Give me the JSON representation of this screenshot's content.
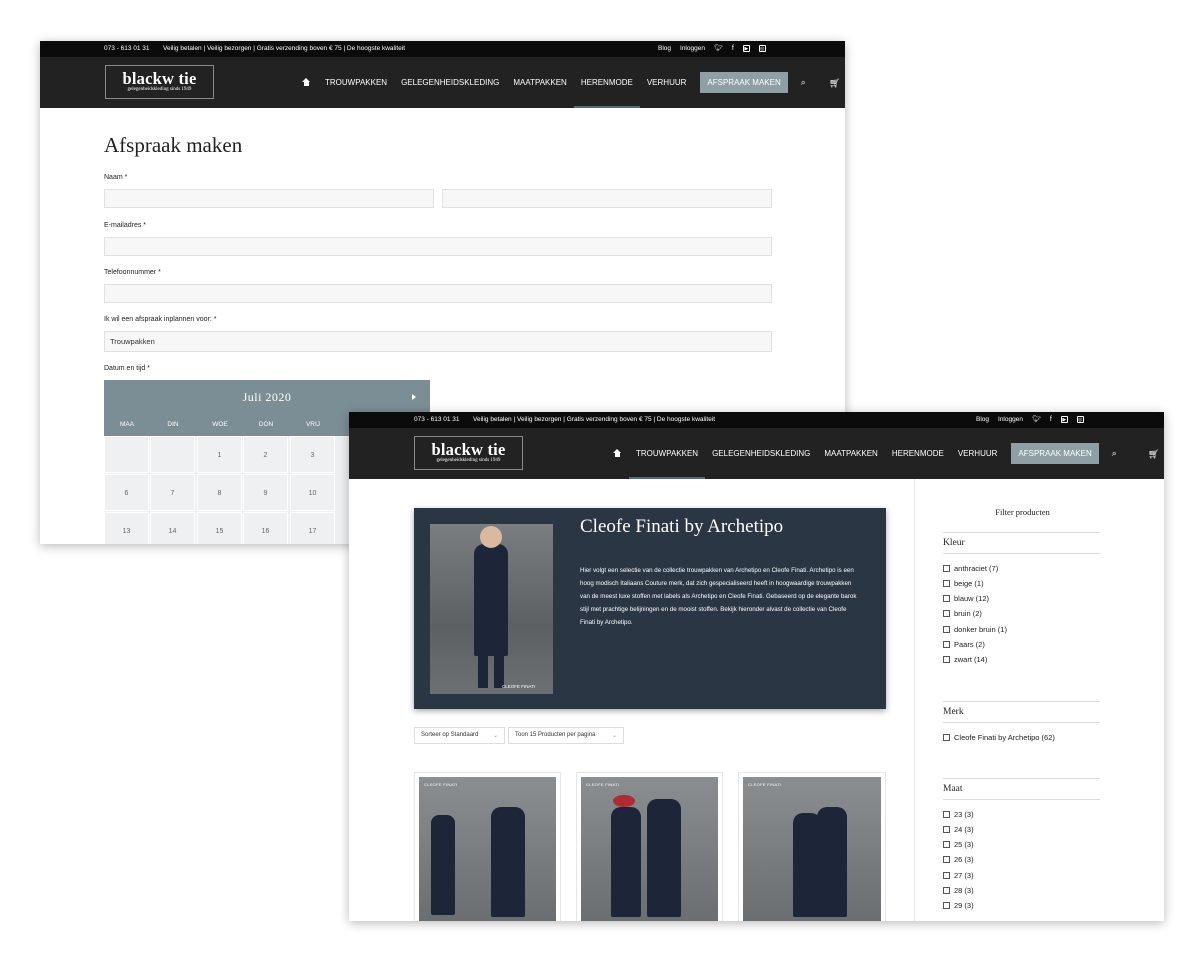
{
  "brand": {
    "name": "blackw tie",
    "tagline": "gelegenheidskleding sinds 1949"
  },
  "topbar": {
    "phone": "073 - 613 01 31",
    "usp": "Veilig betalen | Veilig bezorgen | Gratis verzending boven € 75 | De hoogste kwaliteit",
    "blog": "Blog",
    "login": "Inloggen"
  },
  "icons": {
    "twitter": "twitter-icon",
    "facebook": "facebook-icon",
    "youtube": "youtube-icon",
    "instagram": "instagram-icon",
    "home": "home-icon",
    "search": "search-icon",
    "cart": "cart-icon"
  },
  "nav": {
    "trouwpakken": "TROUWPAKKEN",
    "gelegenheid": "GELEGENHEIDSKLEDING",
    "maatpakken": "MAATPAKKEN",
    "herenmode": "HERENMODE",
    "verhuur": "VERHUUR",
    "cta": "AFSPRAAK MAKEN"
  },
  "form": {
    "title": "Afspraak maken",
    "naam_label": "Naam *",
    "email_label": "E-mailadres *",
    "tel_label": "Telefoonnummer *",
    "reason_label": "Ik wil een afspraak inplannen voor: *",
    "reason_value": "Trouwpakken",
    "date_label": "Datum en tijd *"
  },
  "calendar": {
    "month": "Juli 2020",
    "days": [
      "MAA",
      "DIN",
      "WOE",
      "DON",
      "VRIJ"
    ],
    "rows": [
      [
        "",
        "",
        "1",
        "2",
        "3"
      ],
      [
        "6",
        "7",
        "8",
        "9",
        "10"
      ],
      [
        "13",
        "14",
        "15",
        "16",
        "17"
      ]
    ]
  },
  "category": {
    "title": "Cleofe Finati by Archetipo",
    "description": "Hier volgt een selectie van de collectie trouwpakken van Archetipo en Cleofe Finati. Archetipo is een hoog modisch Italiaans Couture merk, dat zich gespecialiseerd heeft in hoogwaardige trouwpakken van de meest luxe stoffen met labels als Archetipo en Cleofe Finati. Gebaseerd op de elegante barok stijl met prachtige belijningen en de mooist stoffen. Bekijk hieronder alvast de collectie van Cleofe Finati by Archetipo.",
    "image_brand": "CLEOFE FINATI",
    "sort": "Sorteer op Standaard",
    "per_page": "Toon 15 Producten per pagina",
    "product_brand": "CLEOFE FINATI"
  },
  "filters": {
    "title": "Filter producten",
    "kleur_title": "Kleur",
    "kleur": [
      "anthraciet (7)",
      "beige (1)",
      "blauw (12)",
      "bruin (2)",
      "donker bruin (1)",
      "Paars (2)",
      "zwart (14)"
    ],
    "merk_title": "Merk",
    "merk": [
      "Cleofe Finati by Archetipo (62)"
    ],
    "maat_title": "Maat",
    "maat": [
      "23 (3)",
      "24 (3)",
      "25 (3)",
      "26 (3)",
      "27 (3)",
      "28 (3)",
      "29 (3)"
    ]
  }
}
